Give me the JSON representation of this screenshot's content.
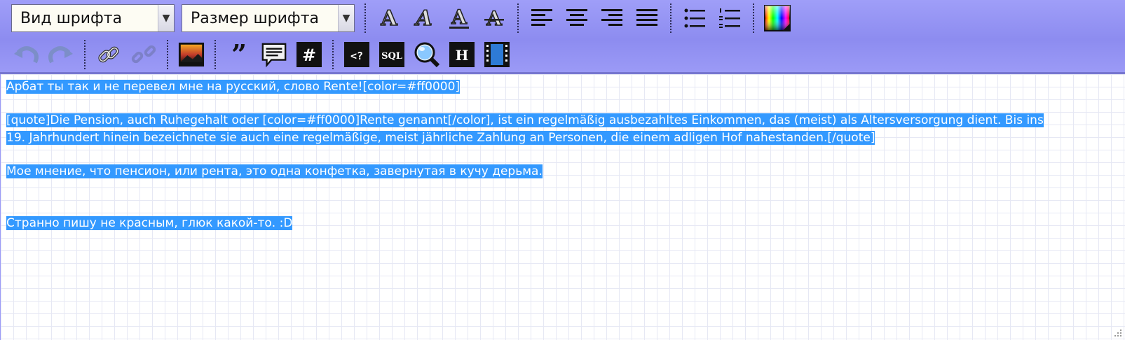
{
  "toolbar": {
    "font_face_select": "Вид шрифта",
    "font_size_select": "Размер шрифта",
    "icons_row1": [
      "bold-icon",
      "italic-icon",
      "underline-icon",
      "strikethrough-icon",
      "align-left-icon",
      "align-center-icon",
      "align-right-icon",
      "align-justify-icon",
      "bullet-list-icon",
      "numbered-list-icon",
      "color-picker-icon"
    ],
    "icons_row2": [
      "undo-icon",
      "redo-icon",
      "link-icon",
      "unlink-icon",
      "image-icon",
      "quote-icon",
      "comment-icon",
      "hash-icon",
      "code-icon",
      "sql-icon",
      "search-icon",
      "header-icon",
      "video-icon"
    ],
    "sql_label": "SQL",
    "hash_label": "#",
    "code_label": "<?",
    "header_label": "H"
  },
  "editor": {
    "lines": [
      "Арбат ты так и не перевел мне на русский, слово Rente![color=#ff0000]",
      "[quote]Die Pension, auch Ruhegehalt oder [color=#ff0000]Rente genannt[/color], ist ein regelmäßig ausbezahltes Einkommen, das (meist) als Altersversorgung dient. Bis ins",
      "19. Jahrhundert hinein bezeichnete sie auch eine regelmäßige, meist jährliche Zahlung an Personen, die einem adligen Hof nahestanden.[/quote]",
      "Мое мнение, что пенсион, или рента, это одна конфетка, завернутая в кучу дерьма.",
      "Странно пишу не красным, глюк какой-то.  :D"
    ],
    "selection_color": "#3399ff"
  },
  "colors": {
    "toolbar_bg": "#8d8cf0",
    "text_selected": "#ffffff"
  }
}
